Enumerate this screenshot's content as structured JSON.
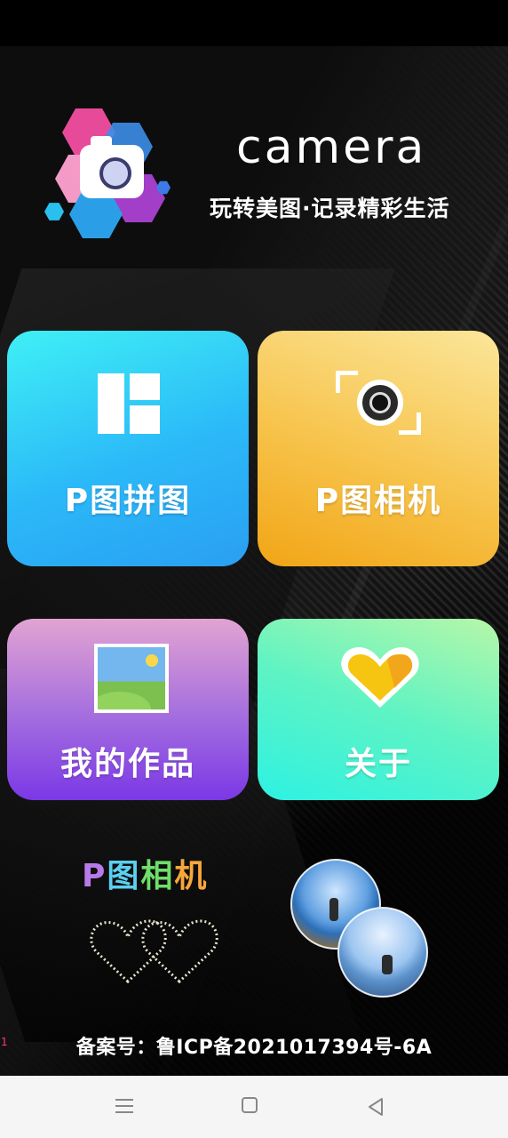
{
  "header": {
    "title": "camera",
    "subtitle": "玩转美图·记录精彩生活"
  },
  "cards": {
    "collage": {
      "label": "P图拼图",
      "icon": "collage-icon"
    },
    "camera": {
      "label": "P图相机",
      "icon": "camera-focus-icon"
    },
    "works": {
      "label": "我的作品",
      "icon": "picture-icon"
    },
    "about": {
      "label": "关于",
      "icon": "heart-icon"
    }
  },
  "promo": {
    "chars": [
      "P",
      "图",
      "相",
      "机"
    ],
    "colors": [
      "#b77ae8",
      "#5bd0f0",
      "#6fde6a",
      "#f7a73b"
    ]
  },
  "footer": {
    "icp": "备案号：鲁ICP备2021017394号-6A",
    "edge_mark": "1"
  },
  "colors": {
    "collage_card": "#2bb9f8",
    "camera_card": "#f7c34b",
    "works_card": "#a36cdf",
    "about_card": "#5ef3c4",
    "nav_bar": "#f5f5f5"
  },
  "nav": {
    "icons": [
      "menu-icon",
      "home-icon",
      "back-icon"
    ]
  }
}
